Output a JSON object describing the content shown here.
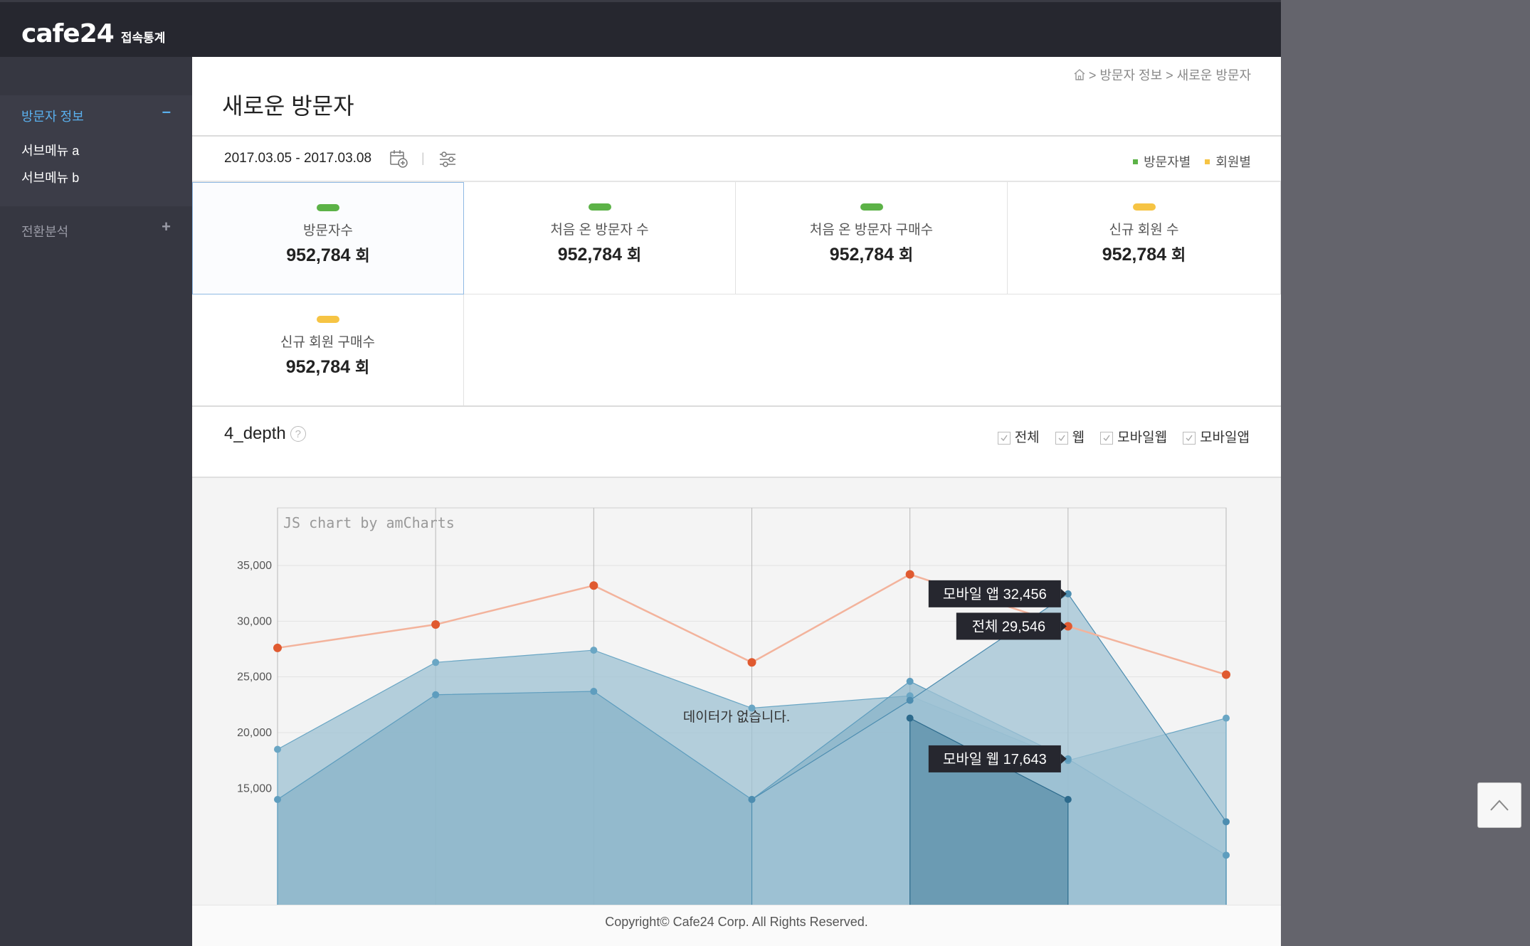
{
  "app": {
    "logo": "cafe24",
    "logo_sub": "접속통계"
  },
  "sidebar": {
    "groups": [
      {
        "label": "방문자 정보",
        "toggle": "–",
        "items": [
          {
            "label": "서브메뉴 a"
          },
          {
            "label": "서브메뉴 b"
          }
        ]
      },
      {
        "label": "전환분석",
        "toggle": "+"
      }
    ]
  },
  "breadcrumb": {
    "path": "> 방문자 정보 > 새로운 방문자"
  },
  "page": {
    "title": "새로운 방문자"
  },
  "date_filter": {
    "range": "2017.03.05 - 2017.03.08",
    "separator": "|"
  },
  "legend": [
    {
      "label": "방문자별",
      "color": "#5cb247"
    },
    {
      "label": "회원별",
      "color": "#f6c444"
    }
  ],
  "cards": [
    {
      "label": "방문자수",
      "value": "952,784",
      "unit": "회",
      "color": "#5cb247"
    },
    {
      "label": "처음 온 방문자 수",
      "value": "952,784",
      "unit": "회",
      "color": "#5cb247"
    },
    {
      "label": "처음 온 방문자 구매수",
      "value": "952,784",
      "unit": "회",
      "color": "#5cb247"
    },
    {
      "label": "신규 회원 수",
      "value": "952,784",
      "unit": "회",
      "color": "#f6c444"
    },
    {
      "label": "신규 회원 구매수",
      "value": "952,784",
      "unit": "회",
      "color": "#f6c444"
    }
  ],
  "section": {
    "title": "4_depth",
    "help": "?"
  },
  "filters": [
    {
      "label": "전체",
      "checked": true
    },
    {
      "label": "웹",
      "checked": true
    },
    {
      "label": "모바일웹",
      "checked": true
    },
    {
      "label": "모바일앱",
      "checked": true
    }
  ],
  "chart_data": {
    "type": "area",
    "credit": "JS chart by amCharts",
    "no_data_text": "데이터가 없습니다.",
    "y_ticks": [
      20000,
      25000,
      30000,
      35000
    ],
    "y_tick_labels": [
      "20,000",
      "25,000",
      "30,000",
      "35,000"
    ],
    "y_bottom_label": "15,000",
    "ylim": [
      15000,
      40000
    ],
    "x_count": 7,
    "grid": true,
    "series": [
      {
        "name": "전체",
        "kind": "line",
        "color": "#e05a30",
        "line_color": "#f3b39c",
        "values": [
          27600,
          29700,
          33200,
          26300,
          34200,
          29546,
          25200
        ]
      },
      {
        "name": "웹",
        "kind": "area",
        "color": "#6aa6c4",
        "fill": "#9dc2d3",
        "fill_opacity": 0.75,
        "values": [
          18500,
          26300,
          27400,
          22200,
          23300,
          17500,
          21300
        ]
      },
      {
        "name": "모바일웹",
        "kind": "area",
        "color": "#5e9dbe",
        "fill": "#86b2c8",
        "fill_opacity": 0.7,
        "values": [
          14000,
          23400,
          23700,
          14000,
          24600,
          17643,
          9000
        ]
      },
      {
        "name": "모바일앱",
        "kind": "area",
        "color": "#4d8db0",
        "fill": "#a0c3d4",
        "fill_opacity": 0.75,
        "values": [
          null,
          null,
          null,
          14000,
          22900,
          32456,
          12000
        ]
      },
      {
        "name": "",
        "kind": "area",
        "color": "#2c6a8c",
        "fill": "#5f91ab",
        "fill_opacity": 0.8,
        "values": [
          null,
          null,
          null,
          null,
          21300,
          14000,
          null
        ]
      }
    ],
    "tooltips": [
      {
        "text": "모바일 앱 32,456",
        "series": 3,
        "index": 5
      },
      {
        "text": "전체 29,546",
        "series": 0,
        "index": 5
      },
      {
        "text": "모바일 웹 17,643",
        "series": 2,
        "index": 5
      }
    ]
  },
  "footer": {
    "copyright": "Copyright© Cafe24 Corp. All Rights Reserved."
  }
}
